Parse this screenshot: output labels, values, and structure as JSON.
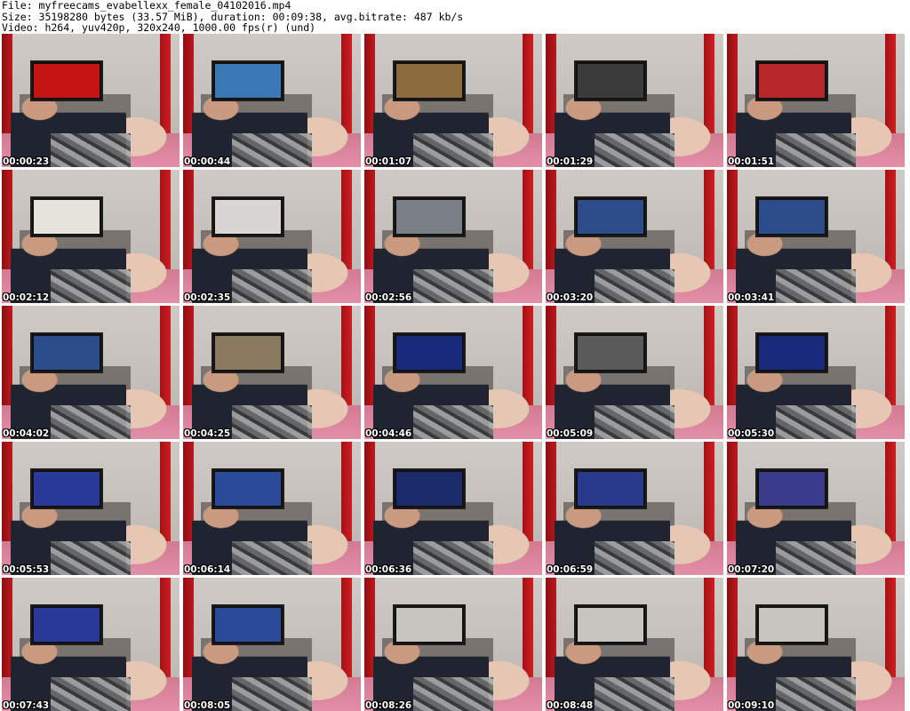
{
  "header": {
    "line1": "File: myfreecams_evabellexx_female_04102016.mp4",
    "line2": "Size: 35198280 bytes (33.57 MiB), duration: 00:09:38, avg.bitrate: 487 kb/s",
    "line3": "Video: h264, yuv420p, 320x240, 1000.00 fps(r) (und)"
  },
  "thumbnails": [
    {
      "time": "00:00:23",
      "screen_color": "#c51414"
    },
    {
      "time": "00:00:44",
      "screen_color": "#3a78b8"
    },
    {
      "time": "00:01:07",
      "screen_color": "#8b6a3c"
    },
    {
      "time": "00:01:29",
      "screen_color": "#3b3b3b"
    },
    {
      "time": "00:01:51",
      "screen_color": "#b8282a"
    },
    {
      "time": "00:02:12",
      "screen_color": "#e6e2dc"
    },
    {
      "time": "00:02:35",
      "screen_color": "#d8d6d2"
    },
    {
      "time": "00:02:56",
      "screen_color": "#7a7f86"
    },
    {
      "time": "00:03:20",
      "screen_color": "#2c4c8a"
    },
    {
      "time": "00:03:41",
      "screen_color": "#2c4c8a"
    },
    {
      "time": "00:04:02",
      "screen_color": "#2c4c8a"
    },
    {
      "time": "00:04:25",
      "screen_color": "#8a7a60"
    },
    {
      "time": "00:04:46",
      "screen_color": "#1a2a7a"
    },
    {
      "time": "00:05:09",
      "screen_color": "#5a5a5a"
    },
    {
      "time": "00:05:30",
      "screen_color": "#1a2a7a"
    },
    {
      "time": "00:05:53",
      "screen_color": "#2a3a9a"
    },
    {
      "time": "00:06:14",
      "screen_color": "#2a4a9a"
    },
    {
      "time": "00:06:36",
      "screen_color": "#1a2a6a"
    },
    {
      "time": "00:06:59",
      "screen_color": "#2a3a8a"
    },
    {
      "time": "00:07:20",
      "screen_color": "#3a3a8a"
    },
    {
      "time": "00:07:43",
      "screen_color": "#2a3a9a"
    },
    {
      "time": "00:08:05",
      "screen_color": "#2a4a9a"
    },
    {
      "time": "00:08:26",
      "screen_color": "#c8c4c0"
    },
    {
      "time": "00:08:48",
      "screen_color": "#c8c4c0"
    },
    {
      "time": "00:09:10",
      "screen_color": "#c8c4c0"
    }
  ]
}
